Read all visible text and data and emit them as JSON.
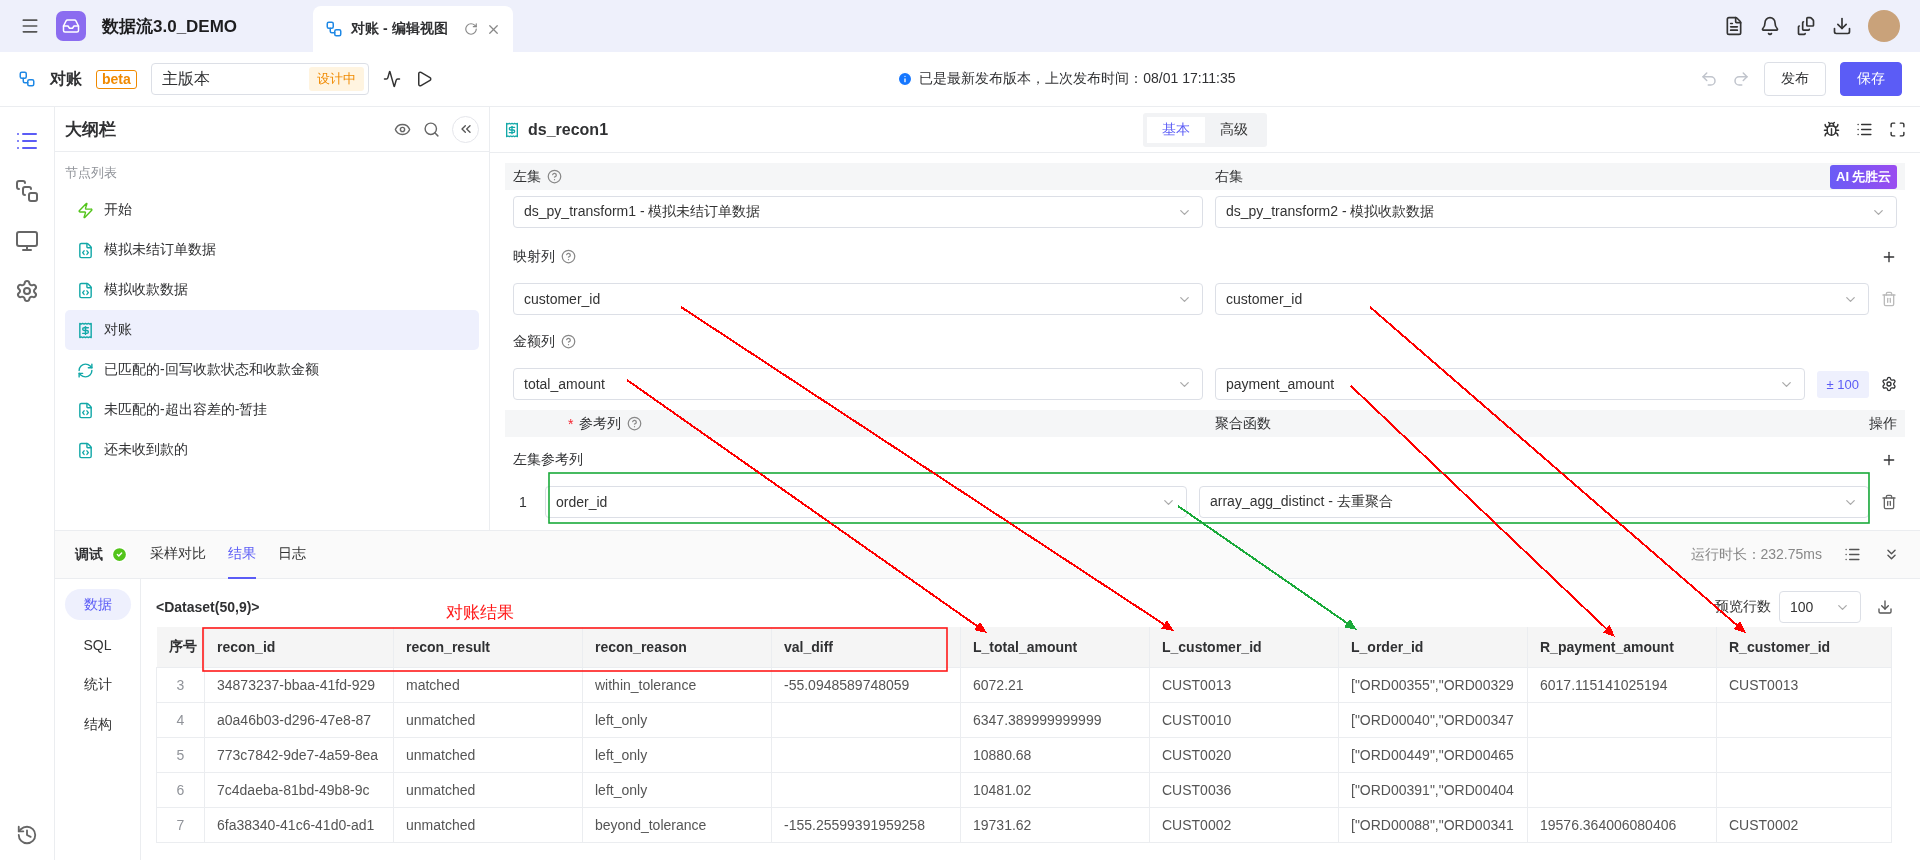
{
  "topbar": {
    "app_name": "数据流3.0_DEMO",
    "tabs": [
      {
        "label": "对账 - 编辑视图",
        "selected": true
      }
    ]
  },
  "toolbar": {
    "title": "对账",
    "badge": "beta",
    "version": {
      "value": "主版本",
      "status": "设计中"
    },
    "notice": "已是最新发布版本，上次发布时间：08/01 17:11:35",
    "buttons": [
      {
        "label": "发布",
        "kind": "default"
      },
      {
        "label": "保存",
        "kind": "primary"
      }
    ]
  },
  "rail": {
    "items": [
      {
        "kind": "outline",
        "selected": true
      },
      {
        "kind": "trigger",
        "selected": false
      },
      {
        "kind": "monitor",
        "selected": false
      },
      {
        "kind": "settings",
        "selected": false
      }
    ]
  },
  "outline": {
    "title": "大纲栏",
    "section": "节点列表",
    "items": [
      {
        "label": "开始",
        "kind": "start",
        "selected": false
      },
      {
        "label": "模拟未结订单数据",
        "kind": "python",
        "selected": false
      },
      {
        "label": "模拟收款数据",
        "kind": "python",
        "selected": false
      },
      {
        "label": "对账",
        "kind": "recon",
        "selected": true
      },
      {
        "label": "已匹配的-回写收款状态和收款金额",
        "kind": "sync",
        "selected": false
      },
      {
        "label": "未匹配的-超出容差的-暂挂",
        "kind": "python",
        "selected": false
      },
      {
        "label": "还未收到款的",
        "kind": "python",
        "selected": false
      }
    ]
  },
  "editor": {
    "title": "ds_recon1",
    "tabs": [
      {
        "label": "基本",
        "selected": true
      },
      {
        "label": "高级",
        "selected": false
      }
    ],
    "left_label": "左集",
    "right_label": "右集",
    "ai_badge": {
      "label": "AI",
      "brand": "先胜云"
    },
    "left_select": "ds_py_transform1 - 模拟未结订单数据",
    "right_select": "ds_py_transform2 - 模拟收款数据",
    "mapping": {
      "label": "映射列",
      "left": "customer_id",
      "right": "customer_id"
    },
    "amount": {
      "label": "金额列",
      "left": "total_amount",
      "right": "payment_amount",
      "tolerance": "± 100"
    },
    "ref_header": {
      "label": "参考列",
      "required_mark": "*",
      "agg": "聚合函数",
      "ops": "操作"
    },
    "ref_section": "左集参考列",
    "ref_rows": [
      {
        "index": "1",
        "column": "order_id",
        "agg": "array_agg_distinct - 去重聚合"
      }
    ]
  },
  "debug": {
    "title": "调试",
    "passed": true,
    "tabs": [
      {
        "label": "采样对比",
        "selected": false
      },
      {
        "label": "结果",
        "selected": true
      },
      {
        "label": "日志",
        "selected": false
      }
    ],
    "runtime": "运行时长：232.75ms",
    "side_tabs": [
      {
        "label": "数据",
        "selected": true
      },
      {
        "label": "SQL",
        "selected": false
      },
      {
        "label": "统计",
        "selected": false
      },
      {
        "label": "结构",
        "selected": false
      }
    ],
    "dataset": "<Dataset(50,9)>",
    "preview_label": "预览行数",
    "preview_value": "100",
    "table": {
      "columns": [
        "序号",
        "recon_id",
        "recon_result",
        "recon_reason",
        "val_diff",
        "L_total_amount",
        "L_customer_id",
        "L_order_id",
        "R_payment_amount",
        "R_customer_id"
      ],
      "rows": [
        [
          "3",
          "34873237-bbaa-41fd-929",
          "matched",
          "within_tolerance",
          "-55.0948589748059",
          "6072.21",
          "CUST0013",
          "[\"ORD00355\",\"ORD00329",
          "6017.115141025194",
          "CUST0013"
        ],
        [
          "4",
          "a0a46b03-d296-47e8-87",
          "unmatched",
          "left_only",
          "",
          "6347.389999999999",
          "CUST0010",
          "[\"ORD00040\",\"ORD00347",
          "",
          ""
        ],
        [
          "5",
          "773c7842-9de7-4a59-8ea",
          "unmatched",
          "left_only",
          "",
          "10880.68",
          "CUST0020",
          "[\"ORD00449\",\"ORD00465",
          "",
          ""
        ],
        [
          "6",
          "7c4daeba-81bd-49b8-9c",
          "unmatched",
          "left_only",
          "",
          "10481.02",
          "CUST0036",
          "[\"ORD00391\",\"ORD00404",
          "",
          ""
        ],
        [
          "7",
          "6fa38340-41c6-41d0-ad1",
          "unmatched",
          "beyond_tolerance",
          "-155.25599391959258",
          "19731.62",
          "CUST0002",
          "[\"ORD00088\",\"ORD00341",
          "19576.364006080406",
          "CUST0002"
        ]
      ]
    }
  },
  "annotations": {
    "label": "对账结果",
    "arrows": [
      {
        "color": "#ff0000"
      },
      {
        "color": "#ff0000"
      },
      {
        "color": "#ff0000"
      },
      {
        "color": "#ff0000"
      },
      {
        "color": "#1aaa3a"
      }
    ]
  }
}
